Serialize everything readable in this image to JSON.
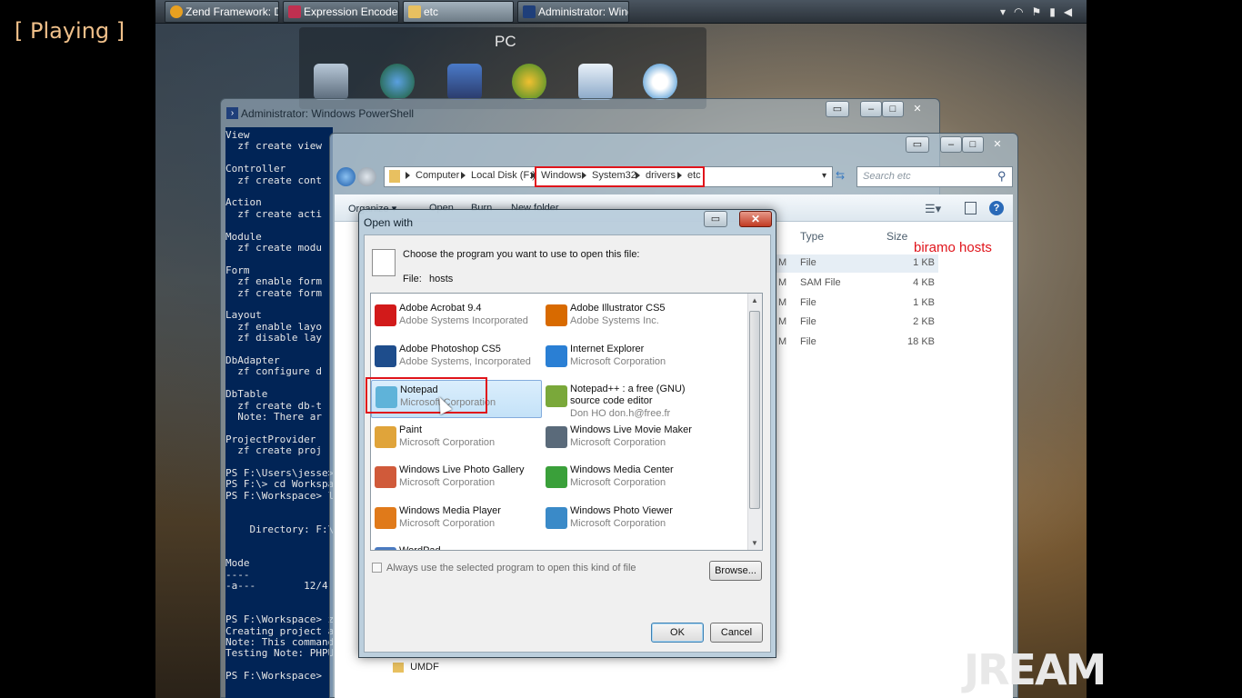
{
  "overlay": {
    "status": "[ Playing ]"
  },
  "taskbar": {
    "items": [
      {
        "label": "Zend Framework: Do..."
      },
      {
        "label": "Expression Encoder S..."
      },
      {
        "label": "etc"
      },
      {
        "label": "Administrator: Wind..."
      }
    ]
  },
  "gadget": {
    "title": "PC"
  },
  "powershell": {
    "title": "Administrator: Windows PowerShell",
    "lines": [
      "View",
      "  zf create view",
      "",
      "Controller",
      "  zf create cont",
      "",
      "Action",
      "  zf create acti",
      "",
      "Module",
      "  zf create modu",
      "",
      "Form",
      "  zf enable form",
      "  zf create form",
      "",
      "Layout",
      "  zf enable layo",
      "  zf disable lay",
      "",
      "DbAdapter",
      "  zf configure d",
      "",
      "DbTable",
      "  zf create db-t",
      "  Note: There ar",
      "",
      "ProjectProvider",
      "  zf create proj",
      "",
      "PS F:\\Users\\jesse>",
      "PS F:\\> cd Workspa",
      "PS F:\\Workspace> l",
      "",
      "",
      "    Directory: F:\\",
      "",
      "",
      "Mode",
      "----",
      "-a---        12/4",
      "",
      "",
      "PS F:\\Workspace> z",
      "Creating project a",
      "Note: This command",
      "Testing Note: PHPU",
      "",
      "PS F:\\Workspace>"
    ]
  },
  "explorer": {
    "breadcrumb": [
      "Computer",
      "Local Disk (F:)",
      "Windows",
      "System32",
      "drivers",
      "etc"
    ],
    "search_placeholder": "Search etc",
    "toolbar": [
      "Organize ▾",
      "Open",
      "Burn",
      "New folder"
    ],
    "columns": {
      "type": "Type",
      "size": "Size"
    },
    "files": [
      {
        "type": "File",
        "size": "1 KB"
      },
      {
        "type": "SAM File",
        "size": "4 KB"
      },
      {
        "type": "File",
        "size": "1 KB"
      },
      {
        "type": "File",
        "size": "2 KB"
      },
      {
        "type": "File",
        "size": "18 KB"
      }
    ],
    "folder_item": "UMDF",
    "annotation": "biramo hosts"
  },
  "dialog": {
    "title": "Open with",
    "prompt": "Choose the program you want to use to open this file:",
    "file_label": "File:",
    "file_name": "hosts",
    "programs": [
      {
        "name": "Adobe Acrobat 9.4",
        "publisher": "Adobe Systems Incorporated",
        "icon": "acrobat-icon",
        "color": "#d21a1a"
      },
      {
        "name": "Adobe Illustrator CS5",
        "publisher": "Adobe Systems Inc.",
        "icon": "illustrator-icon",
        "color": "#d86a00"
      },
      {
        "name": "Adobe Photoshop CS5",
        "publisher": "Adobe Systems, Incorporated",
        "icon": "photoshop-icon",
        "color": "#1e4d8c"
      },
      {
        "name": "Internet Explorer",
        "publisher": "Microsoft Corporation",
        "icon": "internet-explorer-icon",
        "color": "#2a7fd4"
      },
      {
        "name": "Notepad",
        "publisher": "Microsoft Corporation",
        "icon": "notepad-icon",
        "color": "#5fb3d9"
      },
      {
        "name": "Notepad++ : a free (GNU) source code editor",
        "publisher": "Don HO don.h@free.fr",
        "icon": "notepad-plus-plus-icon",
        "color": "#7aa83a"
      },
      {
        "name": "Paint",
        "publisher": "Microsoft Corporation",
        "icon": "paint-icon",
        "color": "#e0a43a"
      },
      {
        "name": "Windows Live Movie Maker",
        "publisher": "Microsoft Corporation",
        "icon": "movie-maker-icon",
        "color": "#5a6a7a"
      },
      {
        "name": "Windows Live Photo Gallery",
        "publisher": "Microsoft Corporation",
        "icon": "photo-gallery-icon",
        "color": "#d05a3a"
      },
      {
        "name": "Windows Media Center",
        "publisher": "Microsoft Corporation",
        "icon": "media-center-icon",
        "color": "#3aa03a"
      },
      {
        "name": "Windows Media Player",
        "publisher": "Microsoft Corporation",
        "icon": "media-player-icon",
        "color": "#e07a1a"
      },
      {
        "name": "Windows Photo Viewer",
        "publisher": "Microsoft Corporation",
        "icon": "photo-viewer-icon",
        "color": "#3a8ac8"
      },
      {
        "name": "WordPad",
        "publisher": "",
        "icon": "wordpad-icon",
        "color": "#4a7ac0"
      }
    ],
    "always_use_label": "Always use the selected program to open this kind of file",
    "browse_label": "Browse...",
    "ok_label": "OK",
    "cancel_label": "Cancel"
  },
  "logo": {
    "text": "JREAM"
  },
  "colors": {
    "highlight_red": "#e0141b",
    "status_text": "#f0c08a"
  }
}
